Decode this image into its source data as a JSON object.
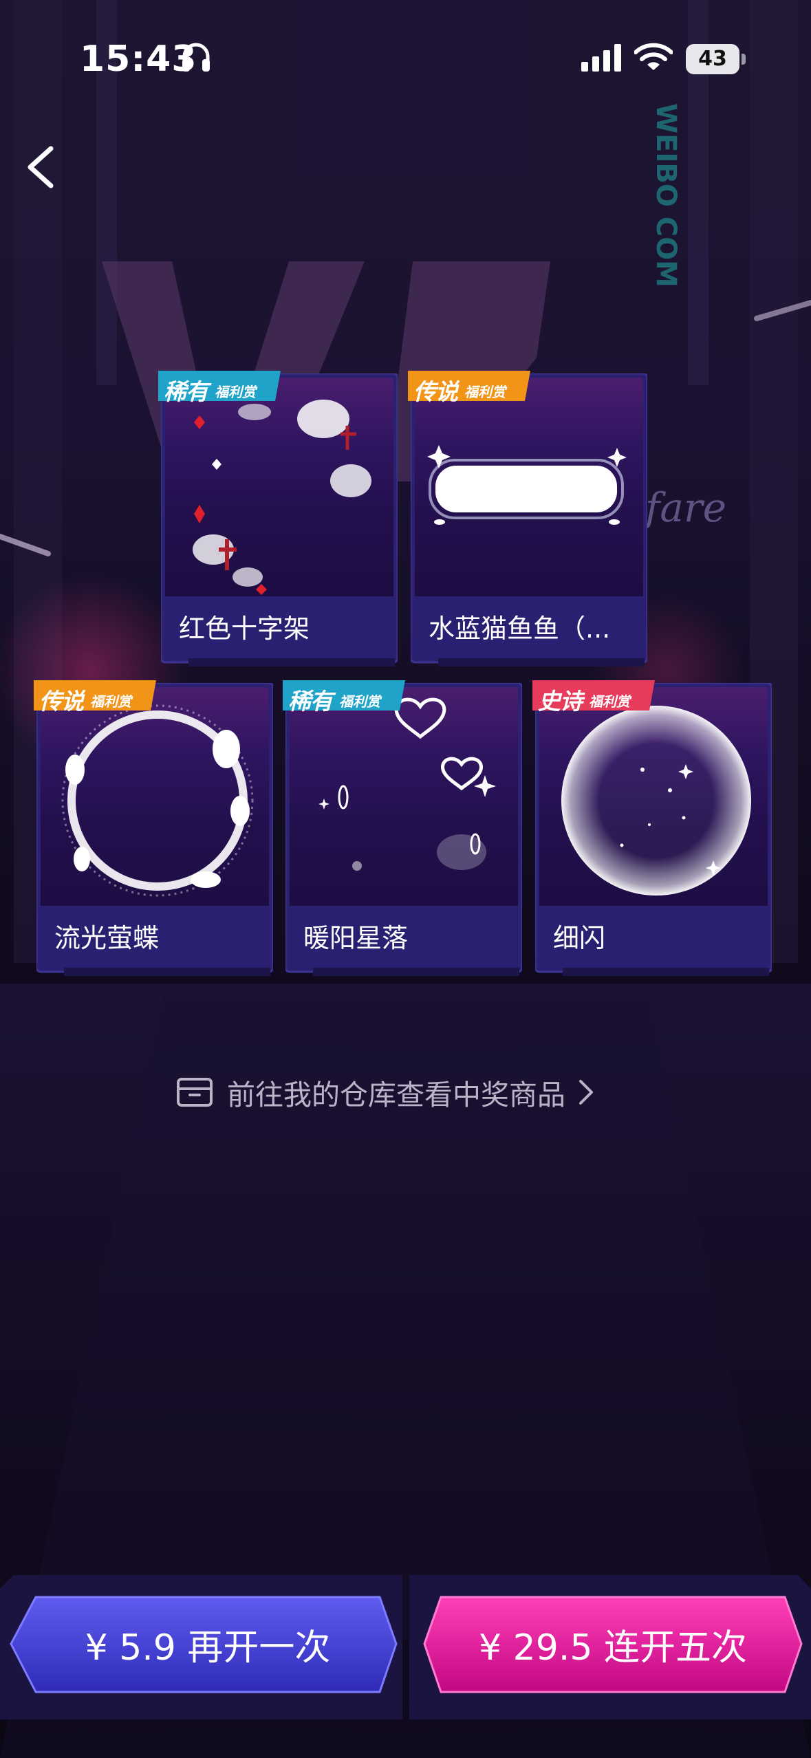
{
  "status_bar": {
    "time": "15:43",
    "battery": "43"
  },
  "prizes": [
    {
      "name": "红色十字架",
      "rarity": "稀有",
      "badge_sub": "福利赏",
      "badge_color": "#1fa3c9"
    },
    {
      "name": "水蓝猫鱼鱼（...",
      "rarity": "传说",
      "badge_sub": "福利赏",
      "badge_color": "#f29418"
    },
    {
      "name": "流光萤蝶",
      "rarity": "传说",
      "badge_sub": "福利赏",
      "badge_color": "#f29418"
    },
    {
      "name": "暖阳星落",
      "rarity": "稀有",
      "badge_sub": "福利赏",
      "badge_color": "#1fa3c9"
    },
    {
      "name": "细闪",
      "rarity": "史诗",
      "badge_sub": "福利赏",
      "badge_color": "#e73b5b"
    }
  ],
  "warehouse_link": {
    "label": "前往我的仓库查看中奖商品"
  },
  "actions": {
    "open_once": "¥ 5.9 再开一次",
    "open_five": "¥ 29.5 连开五次"
  },
  "background_text": {
    "brand_side": "WEIBO COM",
    "welfare": "elfare"
  },
  "colors": {
    "blue_button": "#3f3bd6",
    "pink_button": "#e0179b"
  }
}
